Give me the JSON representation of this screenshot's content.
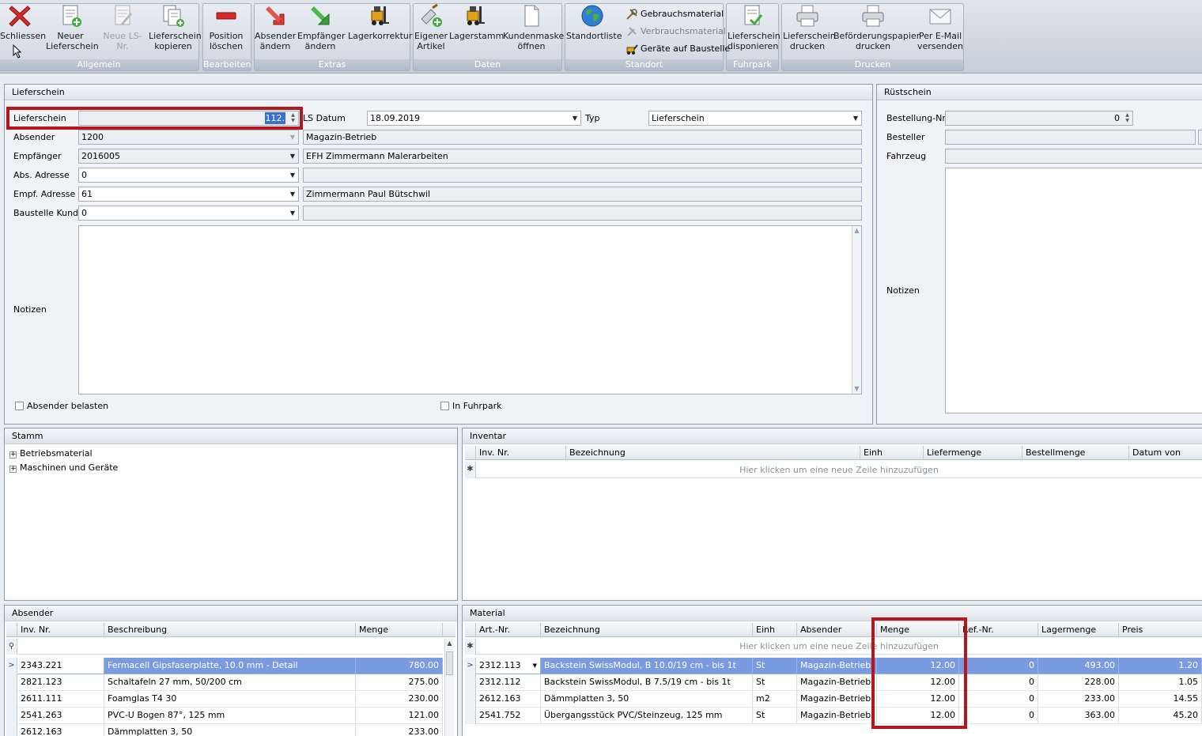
{
  "ribbon": {
    "groups": [
      {
        "label": "Allgemein"
      },
      {
        "label": "Bearbeiten"
      },
      {
        "label": "Extras"
      },
      {
        "label": "Daten"
      },
      {
        "label": "Standort"
      },
      {
        "label": "Fuhrpark"
      },
      {
        "label": "Drucken"
      }
    ],
    "buttons": {
      "schliessen": [
        "Schliessen"
      ],
      "neuer_ls": [
        "Neuer",
        "Lieferschein"
      ],
      "neue_lsnr": [
        "Neue LS-Nr."
      ],
      "ls_kopieren": [
        "Lieferschein",
        "kopieren"
      ],
      "pos_loeschen": [
        "Position",
        "löschen"
      ],
      "abs_aendern": [
        "Absender",
        "ändern"
      ],
      "emp_aendern": [
        "Empfänger",
        "ändern"
      ],
      "lagerkorrektur": [
        "Lagerkorrektur"
      ],
      "eigener_artikel": [
        "Eigener",
        "Artikel"
      ],
      "lagerstamm": [
        "Lagerstamm"
      ],
      "kundenmaske": [
        "Kundenmaske",
        "öffnen"
      ],
      "standortliste": [
        "Standortliste"
      ],
      "ls_disponieren": [
        "Lieferschein",
        "disponieren"
      ],
      "ls_drucken": [
        "Lieferschein",
        "drucken"
      ],
      "befoerderung": [
        "Beförderungspapier",
        "drucken"
      ],
      "email": [
        "Per E-Mail",
        "versenden"
      ]
    },
    "small": {
      "gebrauch": "Gebrauchsmaterial",
      "verbrauch": "Verbrauchsmaterial",
      "geraete": "Geräte auf Baustelle"
    }
  },
  "lieferschein": {
    "title": "Lieferschein",
    "labels": {
      "ls": "Lieferschein",
      "abs": "Absender",
      "emp": "Empfänger",
      "absadr": "Abs. Adresse",
      "empadr": "Empf. Adresse",
      "baustelle": "Baustelle Kunde",
      "notizen": "Notizen",
      "lsdatum": "LS Datum",
      "typ": "Typ"
    },
    "values": {
      "ls": "112.",
      "abs": "1200",
      "abs_name": "Magazin-Betrieb",
      "emp": "2016005",
      "emp_name": "EFH Zimmermann Malerarbeiten",
      "absadr": "0",
      "absadr_name": "",
      "empadr": "61",
      "empadr_name": "Zimmermann Paul Bütschwil",
      "baustelle": "0",
      "baustelle_name": "",
      "lsdatum": "18.09.2019",
      "typ": "Lieferschein"
    },
    "checkboxes": {
      "absender_belasten": "Absender belasten",
      "in_fuhrpark": "In Fuhrpark"
    }
  },
  "ruestschein": {
    "title": "Rüstschein",
    "labels": {
      "bestellnr": "Bestellung-Nr.",
      "besteller": "Besteller",
      "fahrzeug": "Fahrzeug",
      "notizen": "Notizen"
    },
    "values": {
      "bestellnr": "0"
    }
  },
  "stamm": {
    "title": "Stamm",
    "items": [
      "Betriebsmaterial",
      "Maschinen und Geräte"
    ]
  },
  "inventar": {
    "title": "Inventar",
    "columns": [
      "Inv. Nr.",
      "Bezeichnung",
      "Einh",
      "Liefermenge",
      "Bestellmenge",
      "Datum von"
    ],
    "new_row": "Hier klicken um eine neue Zeile hinzuzufügen"
  },
  "absender": {
    "title": "Absender",
    "columns": [
      "Inv. Nr.",
      "Beschreibung",
      "Menge"
    ],
    "rows": [
      [
        "2343.221",
        "Fermacell Gipsfaserplatte, 10.0 mm - Detail",
        "780.00"
      ],
      [
        "2821.123",
        "Schaltafeln 27 mm, 50/200 cm",
        "275.00"
      ],
      [
        "2611.111",
        "Foamglas  T4   30",
        "230.00"
      ],
      [
        "2541.263",
        "PVC-U Bogen 87°, 125 mm",
        "121.00"
      ],
      [
        "2612.163",
        "Dämmplatten 3, 50",
        "233.00"
      ]
    ]
  },
  "material": {
    "title": "Material",
    "columns": [
      "Art.-Nr.",
      "Bezeichnung",
      "Einh",
      "Absender",
      "Menge",
      "Ref.-Nr.",
      "Lagermenge",
      "Preis"
    ],
    "new_row": "Hier klicken um eine neue Zeile hinzuzufügen",
    "rows": [
      [
        "2312.113",
        "Backstein SwissModul, B  10.0/19 cm - bis 1t",
        "St",
        "Magazin-Betrieb",
        "12.00",
        "0",
        "493.00",
        "1.20"
      ],
      [
        "2312.112",
        "Backstein SwissModul, B   7.5/19 cm - bis 1t",
        "St",
        "Magazin-Betrieb",
        "12.00",
        "0",
        "228.00",
        "1.05"
      ],
      [
        "2612.163",
        "Dämmplatten 3, 50",
        "m2",
        "Magazin-Betrieb",
        "12.00",
        "0",
        "233.00",
        "14.55"
      ],
      [
        "2541.752",
        "Übergangsstück PVC/Steinzeug, 125 mm",
        "St",
        "Magazin-Betrieb",
        "12.00",
        "0",
        "363.00",
        "45.20"
      ]
    ]
  }
}
